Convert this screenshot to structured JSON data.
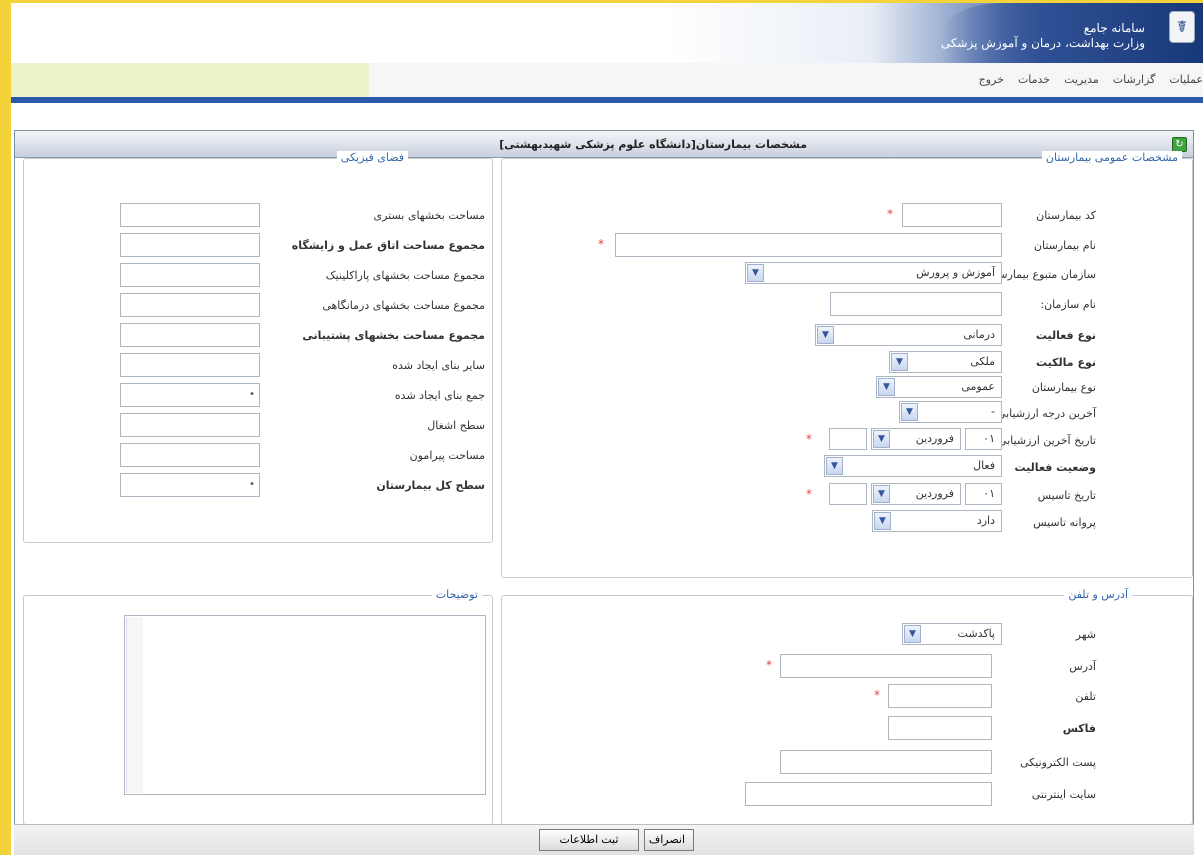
{
  "header": {
    "org_line1": "سامانه جامع",
    "org_line2": "وزارت بهداشت، درمان و آموزش پزشکی"
  },
  "menu": [
    "عملیات",
    "گزارشات",
    "مدیریت",
    "خدمات",
    "خروج"
  ],
  "panel": {
    "title": "مشخصات بیمارستان[دانشگاه علوم پزشکی شهیدبهشتی]"
  },
  "general": {
    "legend": "مشخصات عمومی بیمارستان",
    "labels": {
      "code": "کد بیمارستان",
      "name": "نام بیمارستان",
      "org": "سازمان متبوع بیمارستان",
      "org_name": "نام سازمان:",
      "activity_type": "نوع فعالیت",
      "ownership": "نوع مالکیت",
      "hospital_type": "نوع بیمارستان",
      "last_grade": "آخرین درجه ارزشیابی",
      "last_eval_date": "تاریخ آخرین ارزشیابی",
      "activity_status": "وضعیت فعالیت",
      "founding_date": "تاریخ تاسیس",
      "founding_license": "پروانه تاسیس"
    },
    "values": {
      "org": "آموزش و پرورش",
      "activity_type": "درمانی",
      "ownership": "ملکی",
      "hospital_type": "عمومی",
      "last_grade": "-",
      "eval_day": "۰۱",
      "eval_month": "فروردین",
      "activity_status": "فعال",
      "found_day": "۰۱",
      "found_month": "فروردین",
      "license": "دارد"
    }
  },
  "physical": {
    "legend": "فضای فیزیکی",
    "labels": [
      "مساحت بخشهای بستری",
      "مجموع مساحت اتاق عمل و زایشگاه",
      "مجموع مساحت بخشهای پاراکلینیک",
      "مجموع مساحت بخشهای درمانگاهی",
      "مجموع مساحت بخشهای پشتیبانی",
      "سایر بنای ایجاد شده",
      "جمع بنای ایجاد شده",
      "سطح اشغال",
      "مساحت پیرامون",
      "سطح کل بیمارستان"
    ],
    "computed_marker": "•"
  },
  "address": {
    "legend": "آدرس و تلفن",
    "labels": {
      "city": "شهر",
      "address": "آدرس",
      "phone": "تلفن",
      "fax": "فاکس",
      "email": "پست الکترونیکی",
      "website": "سایت اینترنتی"
    },
    "city_value": "پاکدشت"
  },
  "notes": {
    "legend": "توضیحات"
  },
  "footer": {
    "cancel": "انصراف",
    "submit": "ثبت اطلاعات"
  },
  "colors": {
    "frame": "#f4d33a",
    "header_blue": "#1f3f86",
    "legend_blue": "#3366aa",
    "required": "#e64444"
  }
}
